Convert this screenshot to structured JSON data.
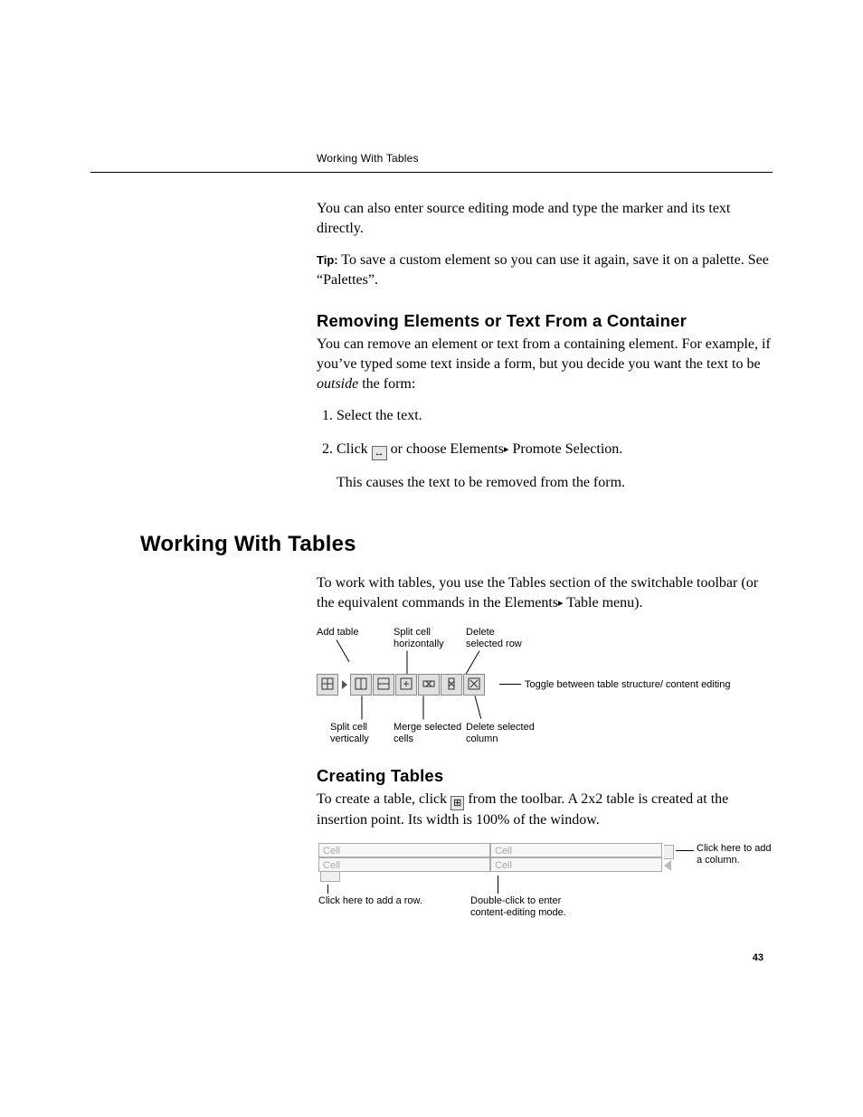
{
  "running_head": "Working With Tables",
  "intro_paragraph": "You can also enter source editing mode and type the marker and its text directly.",
  "tip": {
    "label": "Tip:",
    "text": " To save a custom element so you can use it again, save it on a palette. See “Palettes”."
  },
  "removing": {
    "heading": "Removing Elements or Text From a Container",
    "para": "You can remove an element or text from a containing element. For example, if you’ve typed some text inside a form, but you decide you want the text to be ",
    "para_italic": "outside",
    "para_tail": " the form:",
    "steps": {
      "s1": "Select the text.",
      "s2_a": "Click ",
      "s2_icon": "↔",
      "s2_b": " or choose Elements",
      "s2_arrow": "▸",
      "s2_c": " Promote Selection."
    },
    "result": "This causes the text to be removed from the form."
  },
  "working_heading": "Working With Tables",
  "working_intro_a": "To work with tables, you use the Tables section of the switchable toolbar (or the equivalent commands in the Elements",
  "working_arrow": "▸",
  "working_intro_b": " Table menu).",
  "diagram_labels": {
    "add_table": "Add table",
    "split_h": "Split cell horizontally",
    "del_row": "Delete selected row",
    "split_v": "Split cell vertically",
    "merge": "Merge selected cells",
    "del_col": "Delete selected column",
    "toggle": "Toggle between table structure/ content editing"
  },
  "creating": {
    "heading": "Creating Tables",
    "para_a": "To create a table, click ",
    "para_icon": "⊞",
    "para_b": " from the toolbar. A 2x2 table is created at the insertion point. Its width is 100% of the window."
  },
  "table_fig": {
    "cell_label": "Cell",
    "add_row": "Click here to add a row.",
    "double_click": "Double-click to enter content-editing mode.",
    "add_col": "Click here to add a column."
  },
  "page_number": "43"
}
